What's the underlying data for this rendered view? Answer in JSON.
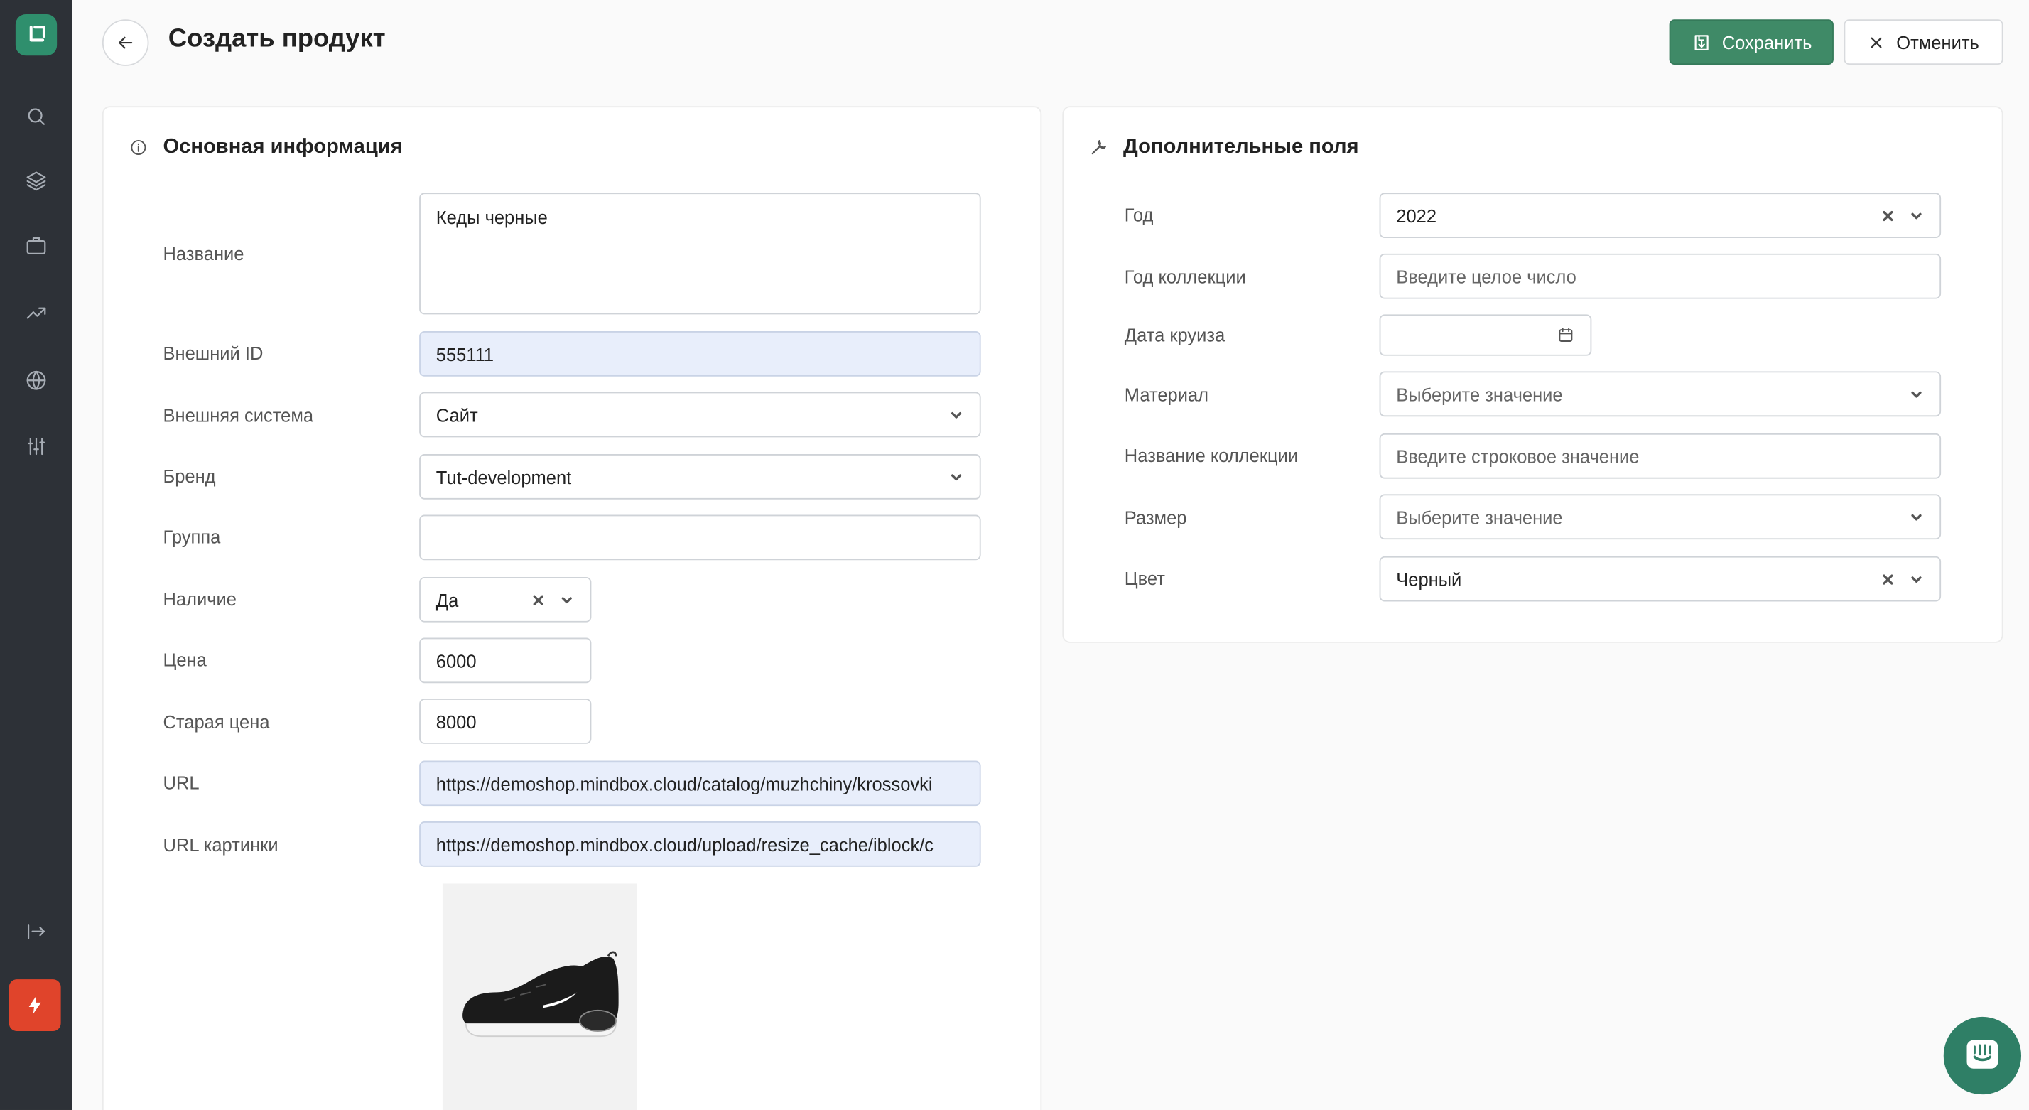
{
  "header": {
    "title": "Создать продукт",
    "save_label": "Сохранить",
    "cancel_label": "Отменить"
  },
  "sidebar": {
    "items": [
      {
        "icon": "search-icon"
      },
      {
        "icon": "layers-icon"
      },
      {
        "icon": "briefcase-icon"
      },
      {
        "icon": "trending-up-icon"
      },
      {
        "icon": "globe-icon"
      },
      {
        "icon": "sliders-icon"
      }
    ]
  },
  "main": {
    "title": "Основная информация",
    "fields": {
      "name_label": "Название",
      "name_value": "Кеды черные",
      "external_id_label": "Внешний ID",
      "external_id_value": "555111",
      "external_system_label": "Внешняя система",
      "external_system_value": "Сайт",
      "brand_label": "Бренд",
      "brand_value": "Tut-development",
      "group_label": "Группа",
      "group_value": "",
      "availability_label": "Наличие",
      "availability_value": "Да",
      "price_label": "Цена",
      "price_value": "6000",
      "old_price_label": "Старая цена",
      "old_price_value": "8000",
      "url_label": "URL",
      "url_value": "https://demoshop.mindbox.cloud/catalog/muzhchiny/krossovki",
      "image_url_label": "URL картинки",
      "image_url_value": "https://demoshop.mindbox.cloud/upload/resize_cache/iblock/c"
    }
  },
  "extra": {
    "title": "Дополнительные поля",
    "fields": {
      "year_label": "Год",
      "year_value": "2022",
      "collection_year_label": "Год коллекции",
      "collection_year_placeholder": "Введите целое число",
      "cruise_date_label": "Дата круиза",
      "material_label": "Материал",
      "material_placeholder": "Выберите значение",
      "collection_name_label": "Название коллекции",
      "collection_name_placeholder": "Введите строковое значение",
      "size_label": "Размер",
      "size_placeholder": "Выберите значение",
      "color_label": "Цвет",
      "color_value": "Черный"
    }
  },
  "colors": {
    "accent": "#3f8a67",
    "sidebar_bg": "#2d3137",
    "danger": "#e0442b",
    "filled_input": "#e8eefb"
  }
}
